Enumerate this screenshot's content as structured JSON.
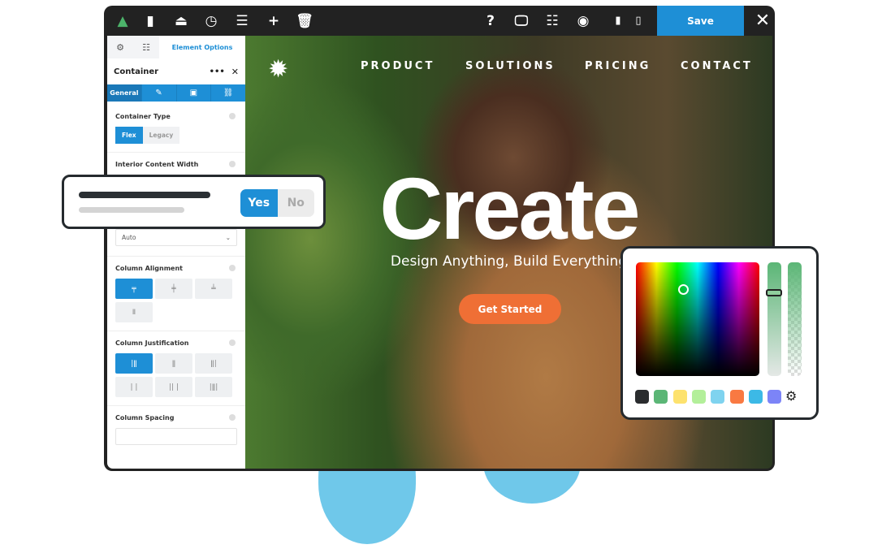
{
  "toolbar": {
    "icons": [
      "logo-icon",
      "sidebar-icon",
      "drive-icon",
      "history-icon",
      "toggle-icon",
      "plus-icon",
      "trash-icon",
      "help-icon",
      "desktop-icon",
      "layout-icon",
      "eye-icon",
      "page-icon",
      "page-outline-icon"
    ],
    "save_label": "Save",
    "close_glyph": "✕"
  },
  "sidebar": {
    "tab_label": "Element Options",
    "element_title": "Container",
    "sub_tabs": [
      "General"
    ],
    "container_type": {
      "label": "Container Type",
      "options": [
        "Flex",
        "Legacy"
      ],
      "selected": "Flex"
    },
    "interior_width": {
      "label": "Interior Content Width",
      "value": "Auto"
    },
    "column_alignment": {
      "label": "Column Alignment"
    },
    "column_justification": {
      "label": "Column Justification"
    },
    "column_spacing": {
      "label": "Column Spacing",
      "value": ""
    }
  },
  "canvas": {
    "nav": [
      "PRODUCT",
      "SOLUTIONS",
      "PRICING",
      "CONTACT"
    ],
    "headline": "Create",
    "subheadline": "Design Anything, Build Everything",
    "cta": "Get Started",
    "cta_color": "#ef6f35"
  },
  "toggle_popup": {
    "yes": "Yes",
    "no": "No",
    "selected": "Yes"
  },
  "color_picker": {
    "swatches": [
      "#2a2c2e",
      "#5bb676",
      "#fde26e",
      "#b3ef9a",
      "#7fd3ef",
      "#f97942",
      "#3cb9e6",
      "#7c84f7"
    ]
  },
  "accent": "#1e8fd6"
}
